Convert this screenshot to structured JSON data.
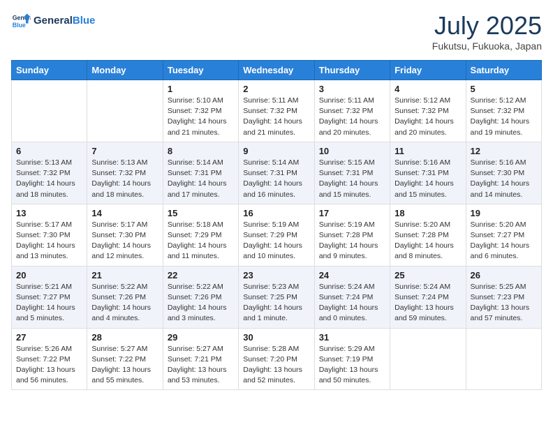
{
  "header": {
    "logo_general": "General",
    "logo_blue": "Blue",
    "month": "July 2025",
    "location": "Fukutsu, Fukuoka, Japan"
  },
  "weekdays": [
    "Sunday",
    "Monday",
    "Tuesday",
    "Wednesday",
    "Thursday",
    "Friday",
    "Saturday"
  ],
  "weeks": [
    [
      {
        "day": "",
        "info": ""
      },
      {
        "day": "",
        "info": ""
      },
      {
        "day": "1",
        "info": "Sunrise: 5:10 AM\nSunset: 7:32 PM\nDaylight: 14 hours and 21 minutes."
      },
      {
        "day": "2",
        "info": "Sunrise: 5:11 AM\nSunset: 7:32 PM\nDaylight: 14 hours and 21 minutes."
      },
      {
        "day": "3",
        "info": "Sunrise: 5:11 AM\nSunset: 7:32 PM\nDaylight: 14 hours and 20 minutes."
      },
      {
        "day": "4",
        "info": "Sunrise: 5:12 AM\nSunset: 7:32 PM\nDaylight: 14 hours and 20 minutes."
      },
      {
        "day": "5",
        "info": "Sunrise: 5:12 AM\nSunset: 7:32 PM\nDaylight: 14 hours and 19 minutes."
      }
    ],
    [
      {
        "day": "6",
        "info": "Sunrise: 5:13 AM\nSunset: 7:32 PM\nDaylight: 14 hours and 18 minutes."
      },
      {
        "day": "7",
        "info": "Sunrise: 5:13 AM\nSunset: 7:32 PM\nDaylight: 14 hours and 18 minutes."
      },
      {
        "day": "8",
        "info": "Sunrise: 5:14 AM\nSunset: 7:31 PM\nDaylight: 14 hours and 17 minutes."
      },
      {
        "day": "9",
        "info": "Sunrise: 5:14 AM\nSunset: 7:31 PM\nDaylight: 14 hours and 16 minutes."
      },
      {
        "day": "10",
        "info": "Sunrise: 5:15 AM\nSunset: 7:31 PM\nDaylight: 14 hours and 15 minutes."
      },
      {
        "day": "11",
        "info": "Sunrise: 5:16 AM\nSunset: 7:31 PM\nDaylight: 14 hours and 15 minutes."
      },
      {
        "day": "12",
        "info": "Sunrise: 5:16 AM\nSunset: 7:30 PM\nDaylight: 14 hours and 14 minutes."
      }
    ],
    [
      {
        "day": "13",
        "info": "Sunrise: 5:17 AM\nSunset: 7:30 PM\nDaylight: 14 hours and 13 minutes."
      },
      {
        "day": "14",
        "info": "Sunrise: 5:17 AM\nSunset: 7:30 PM\nDaylight: 14 hours and 12 minutes."
      },
      {
        "day": "15",
        "info": "Sunrise: 5:18 AM\nSunset: 7:29 PM\nDaylight: 14 hours and 11 minutes."
      },
      {
        "day": "16",
        "info": "Sunrise: 5:19 AM\nSunset: 7:29 PM\nDaylight: 14 hours and 10 minutes."
      },
      {
        "day": "17",
        "info": "Sunrise: 5:19 AM\nSunset: 7:28 PM\nDaylight: 14 hours and 9 minutes."
      },
      {
        "day": "18",
        "info": "Sunrise: 5:20 AM\nSunset: 7:28 PM\nDaylight: 14 hours and 8 minutes."
      },
      {
        "day": "19",
        "info": "Sunrise: 5:20 AM\nSunset: 7:27 PM\nDaylight: 14 hours and 6 minutes."
      }
    ],
    [
      {
        "day": "20",
        "info": "Sunrise: 5:21 AM\nSunset: 7:27 PM\nDaylight: 14 hours and 5 minutes."
      },
      {
        "day": "21",
        "info": "Sunrise: 5:22 AM\nSunset: 7:26 PM\nDaylight: 14 hours and 4 minutes."
      },
      {
        "day": "22",
        "info": "Sunrise: 5:22 AM\nSunset: 7:26 PM\nDaylight: 14 hours and 3 minutes."
      },
      {
        "day": "23",
        "info": "Sunrise: 5:23 AM\nSunset: 7:25 PM\nDaylight: 14 hours and 1 minute."
      },
      {
        "day": "24",
        "info": "Sunrise: 5:24 AM\nSunset: 7:24 PM\nDaylight: 14 hours and 0 minutes."
      },
      {
        "day": "25",
        "info": "Sunrise: 5:24 AM\nSunset: 7:24 PM\nDaylight: 13 hours and 59 minutes."
      },
      {
        "day": "26",
        "info": "Sunrise: 5:25 AM\nSunset: 7:23 PM\nDaylight: 13 hours and 57 minutes."
      }
    ],
    [
      {
        "day": "27",
        "info": "Sunrise: 5:26 AM\nSunset: 7:22 PM\nDaylight: 13 hours and 56 minutes."
      },
      {
        "day": "28",
        "info": "Sunrise: 5:27 AM\nSunset: 7:22 PM\nDaylight: 13 hours and 55 minutes."
      },
      {
        "day": "29",
        "info": "Sunrise: 5:27 AM\nSunset: 7:21 PM\nDaylight: 13 hours and 53 minutes."
      },
      {
        "day": "30",
        "info": "Sunrise: 5:28 AM\nSunset: 7:20 PM\nDaylight: 13 hours and 52 minutes."
      },
      {
        "day": "31",
        "info": "Sunrise: 5:29 AM\nSunset: 7:19 PM\nDaylight: 13 hours and 50 minutes."
      },
      {
        "day": "",
        "info": ""
      },
      {
        "day": "",
        "info": ""
      }
    ]
  ]
}
